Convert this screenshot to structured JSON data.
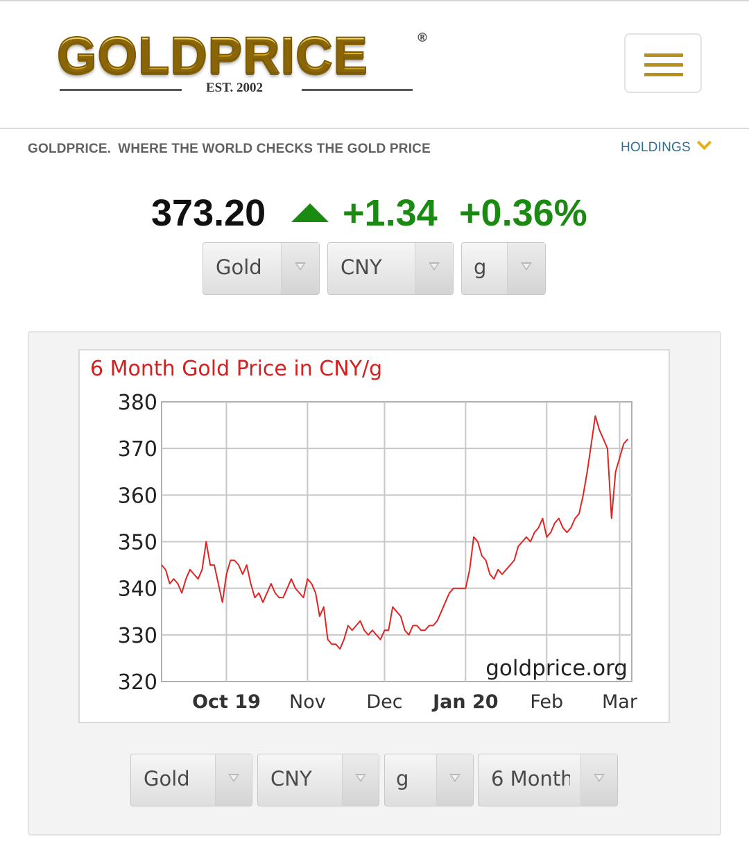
{
  "header": {
    "logo_text": "GOLDPRICE",
    "logo_registered": "®",
    "logo_established": "EST. 2002",
    "menu_icon": "hamburger-menu-icon"
  },
  "tagline": {
    "brand": "GOLDPRICE.",
    "text": "WHERE THE WORLD CHECKS THE GOLD PRICE"
  },
  "holdings": {
    "label": "HOLDINGS",
    "icon": "chevron-down-icon"
  },
  "quote": {
    "price": "373.20",
    "direction_icon": "up-triangle-icon",
    "change": "+1.34",
    "change_percent": "+0.36%",
    "up_color": "#1a8a12"
  },
  "top_selects": [
    {
      "value": "Gold"
    },
    {
      "value": "CNY"
    },
    {
      "value": "g"
    }
  ],
  "bottom_selects": [
    {
      "value": "Gold"
    },
    {
      "value": "CNY"
    },
    {
      "value": "g"
    },
    {
      "value": "6 Month"
    }
  ],
  "chart_data": {
    "type": "line",
    "title": "6 Month Gold Price in CNY/g",
    "watermark": "goldprice.org",
    "line_color": "#e02424",
    "grid": true,
    "y_ticks": [
      "380",
      "370",
      "360",
      "350",
      "340",
      "330",
      "320"
    ],
    "ylim": [
      320,
      380
    ],
    "x_tick_labels": [
      {
        "label": "Oct 19",
        "x": 16,
        "bold": true
      },
      {
        "label": "Nov",
        "x": 36,
        "bold": false
      },
      {
        "label": "Dec",
        "x": 55,
        "bold": false
      },
      {
        "label": "Jan 20",
        "x": 75,
        "bold": true
      },
      {
        "label": "Feb",
        "x": 95,
        "bold": false
      },
      {
        "label": "Mar",
        "x": 113,
        "bold": false
      }
    ],
    "xlim": [
      0,
      116
    ],
    "series": [
      {
        "points": [
          [
            0,
            345
          ],
          [
            1,
            344
          ],
          [
            2,
            341
          ],
          [
            3,
            342
          ],
          [
            4,
            341
          ],
          [
            5,
            339
          ],
          [
            6,
            342
          ],
          [
            7,
            344
          ],
          [
            8,
            343
          ],
          [
            9,
            342
          ],
          [
            10,
            344
          ],
          [
            11,
            350
          ],
          [
            12,
            345
          ],
          [
            13,
            345
          ],
          [
            14,
            341
          ],
          [
            15,
            337
          ],
          [
            16,
            343
          ],
          [
            17,
            346
          ],
          [
            18,
            346
          ],
          [
            19,
            345
          ],
          [
            20,
            343
          ],
          [
            21,
            345
          ],
          [
            22,
            341
          ],
          [
            23,
            338
          ],
          [
            24,
            339
          ],
          [
            25,
            337
          ],
          [
            26,
            339
          ],
          [
            27,
            341
          ],
          [
            28,
            339
          ],
          [
            29,
            338
          ],
          [
            30,
            338
          ],
          [
            31,
            340
          ],
          [
            32,
            342
          ],
          [
            33,
            340
          ],
          [
            34,
            339
          ],
          [
            35,
            338
          ],
          [
            36,
            342
          ],
          [
            37,
            341
          ],
          [
            38,
            339
          ],
          [
            39,
            334
          ],
          [
            40,
            336
          ],
          [
            41,
            329
          ],
          [
            42,
            328
          ],
          [
            43,
            328
          ],
          [
            44,
            327
          ],
          [
            45,
            329
          ],
          [
            46,
            332
          ],
          [
            47,
            331
          ],
          [
            48,
            332
          ],
          [
            49,
            333
          ],
          [
            50,
            331
          ],
          [
            51,
            330
          ],
          [
            52,
            331
          ],
          [
            53,
            330
          ],
          [
            54,
            329
          ],
          [
            55,
            331
          ],
          [
            56,
            331
          ],
          [
            57,
            336
          ],
          [
            58,
            335
          ],
          [
            59,
            334
          ],
          [
            60,
            331
          ],
          [
            61,
            330
          ],
          [
            62,
            332
          ],
          [
            63,
            332
          ],
          [
            64,
            331
          ],
          [
            65,
            331
          ],
          [
            66,
            332
          ],
          [
            67,
            332
          ],
          [
            68,
            333
          ],
          [
            69,
            335
          ],
          [
            70,
            337
          ],
          [
            71,
            339
          ],
          [
            72,
            340
          ],
          [
            73,
            340
          ],
          [
            74,
            340
          ],
          [
            75,
            340
          ],
          [
            76,
            344
          ],
          [
            77,
            351
          ],
          [
            78,
            350
          ],
          [
            79,
            347
          ],
          [
            80,
            346
          ],
          [
            81,
            343
          ],
          [
            82,
            342
          ],
          [
            83,
            344
          ],
          [
            84,
            343
          ],
          [
            85,
            344
          ],
          [
            86,
            345
          ],
          [
            87,
            346
          ],
          [
            88,
            349
          ],
          [
            89,
            350
          ],
          [
            90,
            351
          ],
          [
            91,
            350
          ],
          [
            92,
            352
          ],
          [
            93,
            353
          ],
          [
            94,
            355
          ],
          [
            95,
            351
          ],
          [
            96,
            352
          ],
          [
            97,
            354
          ],
          [
            98,
            355
          ],
          [
            99,
            353
          ],
          [
            100,
            352
          ],
          [
            101,
            353
          ],
          [
            102,
            355
          ],
          [
            103,
            356
          ],
          [
            104,
            360
          ],
          [
            105,
            365
          ],
          [
            106,
            371
          ],
          [
            107,
            377
          ],
          [
            108,
            374
          ],
          [
            109,
            372
          ],
          [
            110,
            370
          ],
          [
            111,
            355
          ],
          [
            112,
            365
          ],
          [
            113,
            368
          ],
          [
            114,
            371
          ],
          [
            115,
            372
          ]
        ]
      }
    ]
  }
}
